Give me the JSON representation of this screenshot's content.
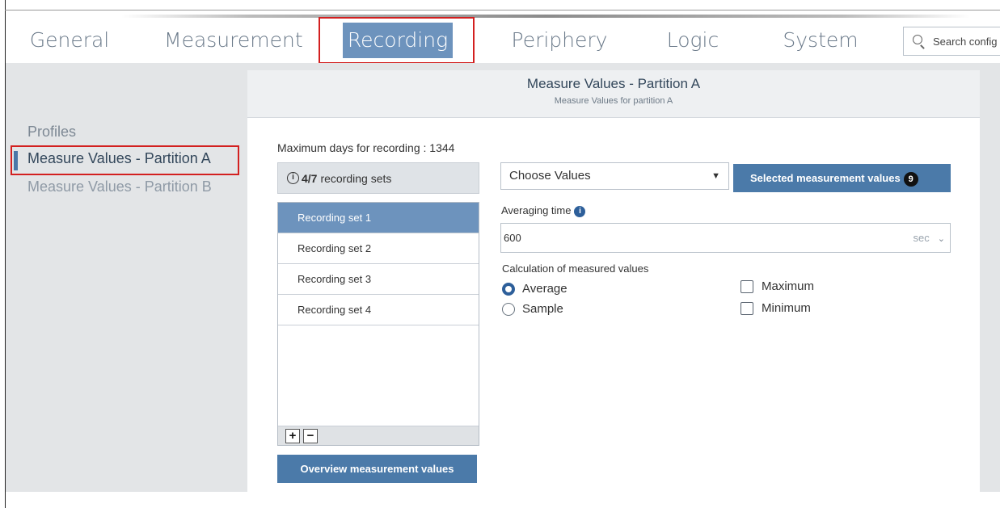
{
  "nav": {
    "tabs": [
      {
        "label": "General"
      },
      {
        "label": "Measurement"
      },
      {
        "label": "Recording"
      },
      {
        "label": "Periphery"
      },
      {
        "label": "Logic"
      },
      {
        "label": "System"
      }
    ],
    "active_tab": "Recording",
    "search": {
      "placeholder": "Search config",
      "icon": "search-icon"
    }
  },
  "sidebar": {
    "title": "Profiles",
    "items": [
      {
        "label": "Measure Values - Partition A",
        "active": true
      },
      {
        "label": "Measure Values - Partition B",
        "active": false
      }
    ]
  },
  "panel": {
    "title": "Measure Values - Partition A",
    "subtitle": "Measure Values for partition A",
    "max_days_text": "Maximum days for recording : 1344",
    "recording_sets": {
      "count": "4/7",
      "label": "recording sets",
      "items": [
        {
          "label": "Recording set 1",
          "selected": true
        },
        {
          "label": "Recording set 2",
          "selected": false
        },
        {
          "label": "Recording set 3",
          "selected": false
        },
        {
          "label": "Recording set 4",
          "selected": false
        }
      ],
      "add_label": "+",
      "remove_label": "−"
    },
    "overview_button": "Overview measurement values",
    "choose_values": {
      "value": "Choose Values",
      "arrow": "▼"
    },
    "selected_button": {
      "label": "Selected measurement values",
      "badge": "9"
    },
    "averaging_time": {
      "label": "Averaging time",
      "value": "600",
      "unit": "sec",
      "unit_chevron": "⌄"
    },
    "calculation": {
      "label": "Calculation of measured values",
      "radios": [
        {
          "label": "Average",
          "checked": true
        },
        {
          "label": "Sample",
          "checked": false
        }
      ],
      "checkboxes": [
        {
          "label": "Maximum",
          "checked": false
        },
        {
          "label": "Minimum",
          "checked": false
        }
      ]
    }
  },
  "colors": {
    "accent": "#6d93bd",
    "button": "#4b7aa9",
    "highlight": "#d32020",
    "background": "#e3e5e7"
  }
}
